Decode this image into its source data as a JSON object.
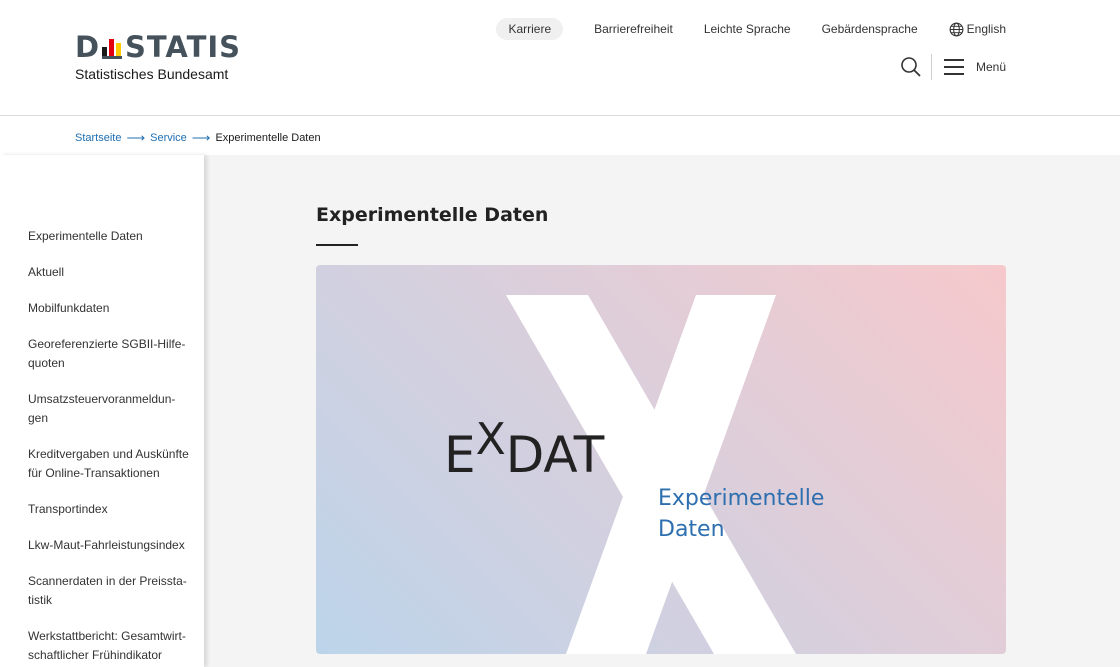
{
  "header": {
    "logo": {
      "brand_left": "D",
      "brand_right": "STATIS",
      "subtitle": "Statistisches Bundesamt"
    },
    "topnav": {
      "karriere": "Karriere",
      "barrierefreiheit": "Barrierefreiheit",
      "leichte_sprache": "Leichte Sprache",
      "gebaerdensprache": "Gebärdensprache",
      "english": "English"
    },
    "tools": {
      "menu_label": "Menü"
    }
  },
  "breadcrumb": {
    "items": [
      "Startseite",
      "Service"
    ],
    "current": "Experimentelle Daten"
  },
  "sidebar": {
    "items": [
      "Experimentelle Daten",
      "Aktuell",
      "Mobilfunkdaten",
      "Georeferenzierte SGBII-Hilfe-quoten",
      "Umsatzsteuervoranmeldun-gen",
      "Kreditvergaben und Auskünfte für Online-Transaktionen",
      "Transportindex",
      "Lkw-Maut-Fahrleistungsindex",
      "Scannerdaten in der Preissta-tistik",
      "Werkstattbericht: Gesamtwirt-schaftlicher Frühindikator"
    ]
  },
  "main": {
    "title": "Experimentelle Daten",
    "hero": {
      "logo_e": "E",
      "logo_x": "X",
      "logo_dat": "DAT",
      "subtitle_line1": "Experimentelle",
      "subtitle_line2": "Daten"
    }
  },
  "colors": {
    "link": "#1f6fb2",
    "hero_text_blue": "#2e6fb0",
    "logo_grey": "#45525c"
  }
}
